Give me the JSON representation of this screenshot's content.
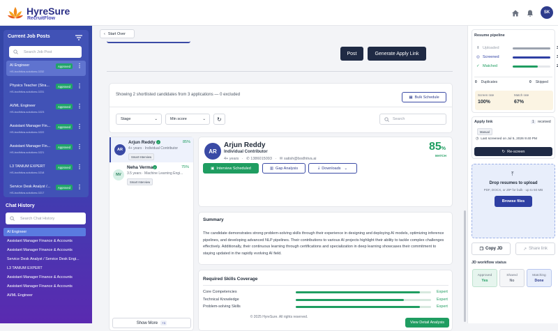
{
  "brand": {
    "name": "HyreSure",
    "tagline": "RecruitFlow"
  },
  "topbar": {
    "avatar_initials": "SK"
  },
  "sidebar": {
    "job_posts_title": "Current Job Posts",
    "search_placeholder": "Search Job Post",
    "jobs": [
      {
        "title": "AI Engineer",
        "id": "HS-bodhitva-solutions-0232",
        "status": "Approved",
        "active": true
      },
      {
        "title": "Physics Teacher (Stra...",
        "id": "HS-bodhitva-solutions-0231",
        "status": "Approved",
        "active": false
      },
      {
        "title": "AI/ML Engineer",
        "id": "HS-bodhitva-solutions-0223",
        "status": "Approved",
        "active": false
      },
      {
        "title": "Assistant Manager Fin...",
        "id": "HS-bodhitva-solutions-0222",
        "status": "Approved",
        "active": false
      },
      {
        "title": "Assistant Manager Fin...",
        "id": "HS-bodhitva-solutions-0221",
        "status": "Approved",
        "active": false
      },
      {
        "title": "L3 TANIUM EXPERT",
        "id": "HS-bodhitva-solutions-0218",
        "status": "Approved",
        "active": false
      },
      {
        "title": "Service Desk Analyst /...",
        "id": "HS-bodhitva-solutions-0217",
        "status": "Approved",
        "active": false
      }
    ],
    "chat_history_title": "Chat History",
    "chat_search_placeholder": "Search Chat History",
    "chats": [
      {
        "label": "AI Engineer",
        "active": true
      },
      {
        "label": "Assistant Manager Finance & Accounts",
        "active": false
      },
      {
        "label": "Assistant Manager Finance & Accounts",
        "active": false
      },
      {
        "label": "Service Desk Analyst / Service Desk Engi...",
        "active": false
      },
      {
        "label": "L3 TANIUM EXPERT",
        "active": false
      },
      {
        "label": "Assistant Manager Finance & Accounts",
        "active": false
      },
      {
        "label": "Assistant Manager Finance & Accounts",
        "active": false
      },
      {
        "label": "AI/ML Engineer",
        "active": false
      }
    ]
  },
  "main": {
    "start_over": "Start Over",
    "post_button": "Post",
    "generate_link_button": "Generate Apply Link",
    "summary_text": "Showing 2 shortlisted candidates from 3 applications — 0 excluded",
    "bulk_schedule": "Bulk Schedule",
    "filter_stage": "Stage",
    "filter_score": "Min score",
    "search_placeholder": "Search",
    "candidates": [
      {
        "initials": "AR",
        "name": "Arjun Reddy",
        "exp": "4+ years",
        "role": "Individual Contributor",
        "score": "85%",
        "badge": "Smart Interview",
        "selected": true
      },
      {
        "initials": "NV",
        "name": "Neha Verma",
        "exp": "3.5 years",
        "role": "Machine Learning Engi...",
        "score": "75%",
        "badge": "Smart Interview",
        "selected": false
      }
    ],
    "show_more": "Show More",
    "show_more_count": "+1",
    "detail": {
      "initials": "AR",
      "name": "Arjun Reddy",
      "role": "Individual Contributor",
      "exp": "4+ years",
      "phone": "1386015093",
      "email": "satish@bodhitva.ai",
      "score_number": "85",
      "score_unit": "%",
      "score_label": "MATCH",
      "interview_button": "Interview Scheduled",
      "gap_button": "Gap Analysis",
      "downloads_button": "Downloads",
      "summary_title": "Summary",
      "summary_body": "The candidate demonstrates strong problem-solving skills through their experience in designing and deploying AI models, optimizing inference pipelines, and developing advanced NLP pipelines. Their contributions to various AI projects highlight their ability to tackle complex challenges effectively. Additionally, their continuous learning through certifications and specialization in deep learning showcases their commitment to staying updated in the rapidly evolving AI field.",
      "skills_title": "Required Skills Coverage",
      "skills": [
        {
          "name": "Core Competencies",
          "level": "Expert",
          "coverage": 0.92
        },
        {
          "name": "Technical Knowledge",
          "level": "Expert",
          "coverage": 0.8
        },
        {
          "name": "Problem-solving Skills",
          "level": "Expert",
          "coverage": 0.92
        }
      ],
      "view_detail_button": "View Detail Analysis"
    },
    "footer": "© 2025 HyreSure. All rights reserved."
  },
  "right": {
    "pipeline_title": "Resume pipeline",
    "pipeline": [
      {
        "label": "Uploaded",
        "value": "3",
        "fill": 1.0,
        "color": "#9ca3af"
      },
      {
        "label": "Screened",
        "value": "3",
        "fill": 1.0,
        "color": "#2e3fa3"
      },
      {
        "label": "Matched",
        "value": "2",
        "fill": 0.67,
        "color": "#1f9d61"
      }
    ],
    "duplicates_label": "Duplicates",
    "duplicates_value": "0",
    "skipped_label": "Skipped",
    "skipped_value": "0",
    "screen_rate_label": "Screen rate",
    "screen_rate_value": "100%",
    "match_rate_label": "Match rate",
    "match_rate_value": "67%",
    "apply_link_title": "Apply link",
    "received_count": "1",
    "received_label": "received",
    "manual_badge": "Manual",
    "last_screened": "Last screened on Jul 5, 2026 9:40 PM",
    "rescreen_button": "Re-screen",
    "drop_title": "Drop resumes to upload",
    "drop_sub": "PDF, DOCX, or ZIP for bulk · up to 50 MB",
    "browse_button": "Browse files",
    "copy_jd": "Copy JD",
    "share_link": "Share link",
    "workflow_title": "JD workflow status",
    "workflow": [
      {
        "label": "Approved",
        "value": "Yes"
      },
      {
        "label": "Shared",
        "value": "No"
      },
      {
        "label": "Matching",
        "value": "Done"
      }
    ]
  }
}
